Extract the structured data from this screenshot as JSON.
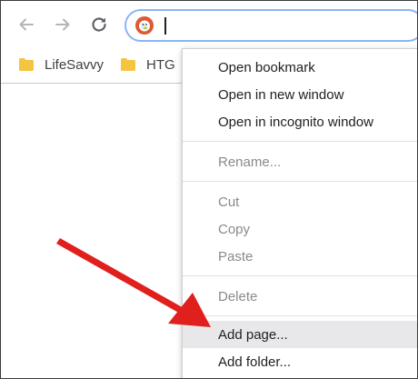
{
  "toolbar": {
    "back_icon": "back-arrow-icon",
    "forward_icon": "forward-arrow-icon",
    "reload_icon": "reload-icon",
    "search_engine_icon": "duckduckgo-icon",
    "address_value": ""
  },
  "bookmarks": [
    {
      "label": "LifeSavvy",
      "icon": "folder-icon"
    },
    {
      "label": "HTG",
      "icon": "folder-icon"
    }
  ],
  "context_menu": {
    "items": [
      {
        "label": "Open bookmark",
        "enabled": true
      },
      {
        "label": "Open in new window",
        "enabled": true
      },
      {
        "label": "Open in incognito window",
        "enabled": true
      },
      {
        "label": "Rename...",
        "enabled": false
      },
      {
        "label": "Cut",
        "enabled": false
      },
      {
        "label": "Copy",
        "enabled": false
      },
      {
        "label": "Paste",
        "enabled": false
      },
      {
        "label": "Delete",
        "enabled": false
      },
      {
        "label": "Add page...",
        "enabled": true,
        "highlighted": true
      },
      {
        "label": "Add folder...",
        "enabled": true
      }
    ]
  },
  "colors": {
    "annotation_arrow": "#e0201c",
    "folder": "#f5c542",
    "highlight": "#e8e8ea"
  }
}
